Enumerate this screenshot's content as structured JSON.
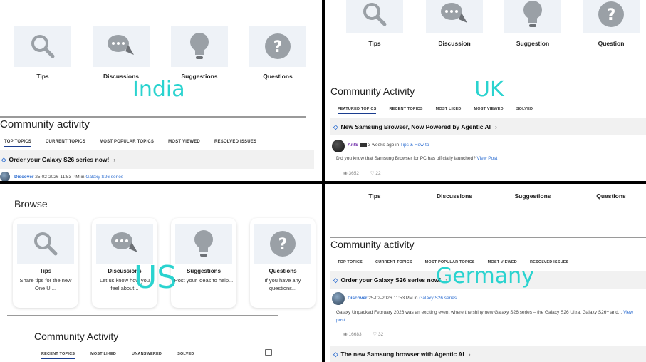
{
  "india": {
    "categories": [
      "Tips",
      "Discussions",
      "Suggestions",
      "Questions"
    ],
    "overlay_label": "India",
    "section_title": "Community activity",
    "tabs": [
      "TOP TOPICS",
      "CURRENT TOPICS",
      "MOST POPULAR TOPICS",
      "MOST VIEWED",
      "RESOLVED ISSUES"
    ],
    "topic": "Order your Galaxy S26 series now!",
    "post_author": "Discover",
    "post_meta": "25-02-2026 11:53 PM in",
    "post_board": "Galaxy S26 series"
  },
  "uk": {
    "categories": [
      "Tips",
      "Discussion",
      "Suggestion",
      "Question"
    ],
    "overlay_label": "UK",
    "section_title": "Community Activity",
    "tabs": [
      "FEATURED TOPICS",
      "RECENT TOPICS",
      "MOST LIKED",
      "MOST VIEWED",
      "SOLVED"
    ],
    "topic": "New Samsung Browser, Now Powered by Agentic AI",
    "post_author": "AntS",
    "post_meta": "3 weeks ago in",
    "post_board": "Tips & How-to",
    "post_body": "Did you know that Samsung Browser for PC has officially launched?",
    "view_post": "View Post",
    "views": "3652",
    "likes": "22"
  },
  "us": {
    "browse_title": "Browse",
    "overlay_label": "US",
    "cards": [
      {
        "title": "Tips",
        "desc": "Share tips for the new One UI..."
      },
      {
        "title": "Discussions",
        "desc": "Let us know how you feel about..."
      },
      {
        "title": "Suggestions",
        "desc": "Post your ideas to help..."
      },
      {
        "title": "Questions",
        "desc": "If you have any questions..."
      }
    ],
    "section_title": "Community Activity",
    "tabs": [
      "RECENT TOPICS",
      "MOST LIKED",
      "UNANSWERED",
      "SOLVED"
    ]
  },
  "germany": {
    "categories": [
      "Tips",
      "Discussions",
      "Suggestions",
      "Questions"
    ],
    "overlay_label": "Germany",
    "section_title": "Community activity",
    "tabs": [
      "TOP TOPICS",
      "CURRENT TOPICS",
      "MOST POPULAR TOPICS",
      "MOST VIEWED",
      "RESOLVED ISSUES"
    ],
    "topic": "Order your Galaxy S26 series now!",
    "post_author": "Discover",
    "post_meta": "25-02-2026 11:53 PM in",
    "post_board": "Galaxy S26 series",
    "post_body": "Galaxy Unpacked February 2026 was an exciting event where the shiny new Galaxy S26 series – the Galaxy S26 Ultra, Galaxy S26+ and...",
    "view_post": "View post",
    "views": "16683",
    "likes": "32",
    "topic2": "The new Samsung browser with Agentic AI"
  },
  "colors": {
    "overlay": "#2ad3cf",
    "link": "#2f6fd1",
    "icon_bg": "#eef2f7",
    "tab_active": "#1a3d8f"
  }
}
